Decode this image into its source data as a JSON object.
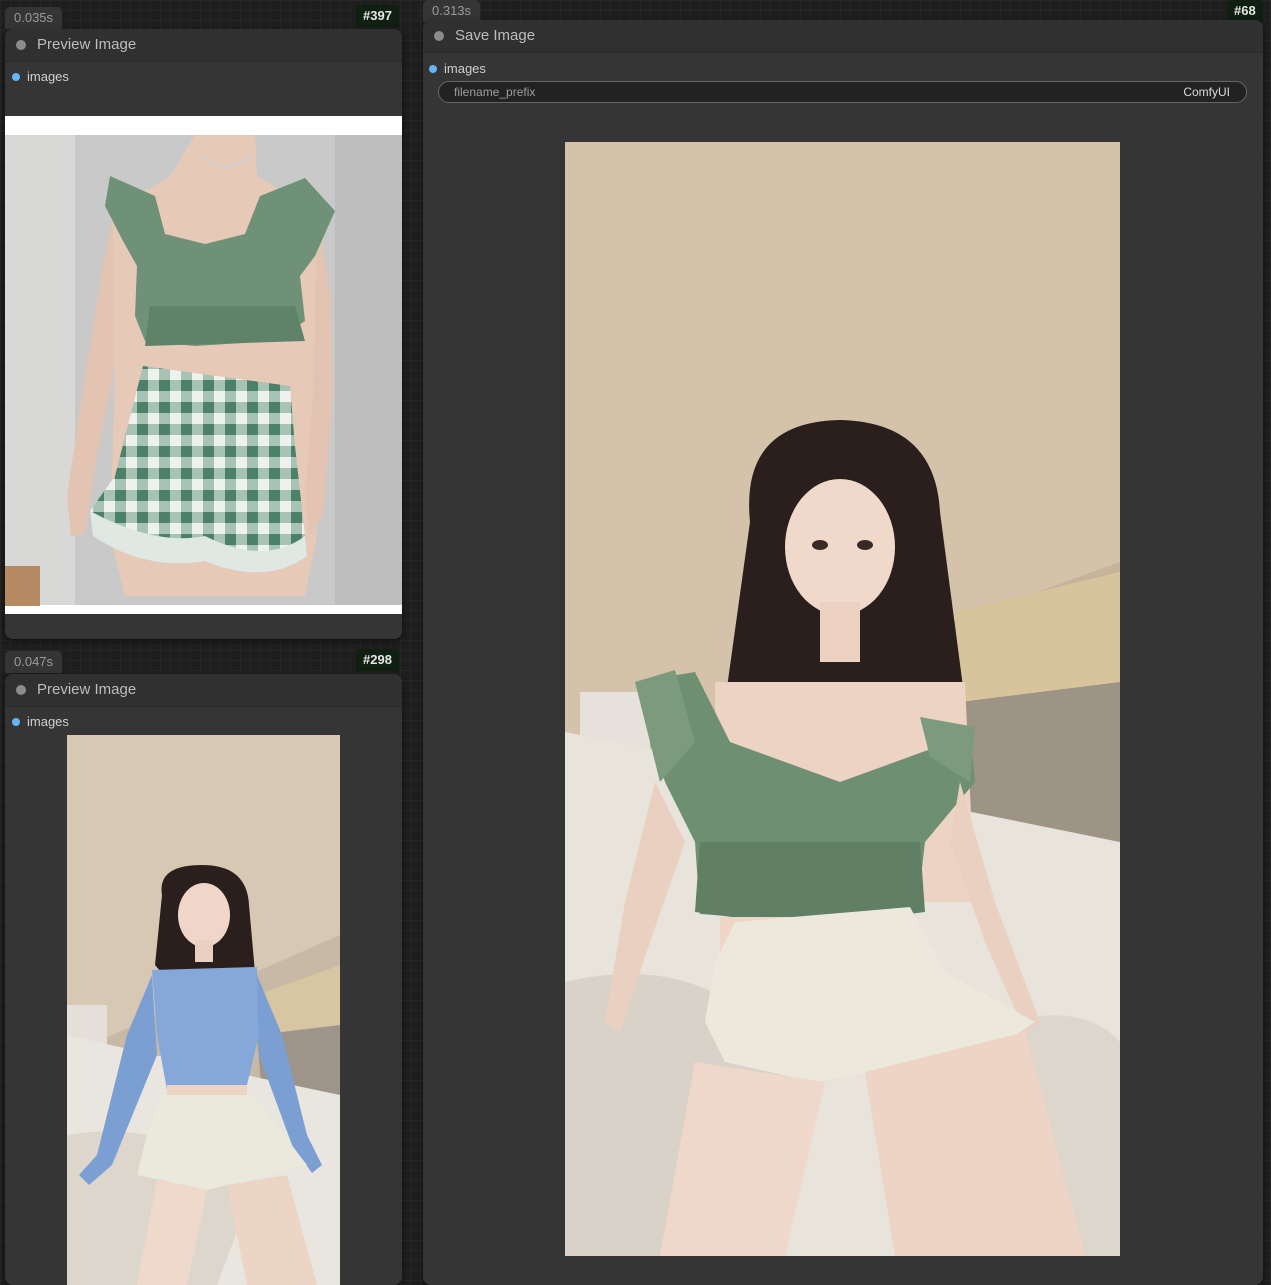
{
  "nodes": [
    {
      "time": "0.035s",
      "id": "#397",
      "title": "Preview Image",
      "input": "images",
      "image": "Product photo: torso in green ruffled crop top and green/white gingham ruffle mini skirt on white background"
    },
    {
      "time": "0.047s",
      "id": "#298",
      "title": "Preview Image",
      "input": "images",
      "image": "Photo: young woman with long dark hair sitting on a bed wearing a light blue off-shoulder long-sleeve crop top and cream mini skirt"
    },
    {
      "time": "0.313s",
      "id": "#68",
      "title": "Save Image",
      "input": "images",
      "widget": {
        "name": "filename_prefix",
        "value": "ComfyUI"
      },
      "image": "Photo: young woman with long dark hair sitting on a bed wearing the green ruffled crop top and cream mini skirt"
    }
  ],
  "colors": {
    "canvas": "#1e1e1e",
    "node_body": "#353535",
    "node_header": "#303030",
    "input_slot": "#64b5f6",
    "id_badge": "#0f1f10"
  }
}
